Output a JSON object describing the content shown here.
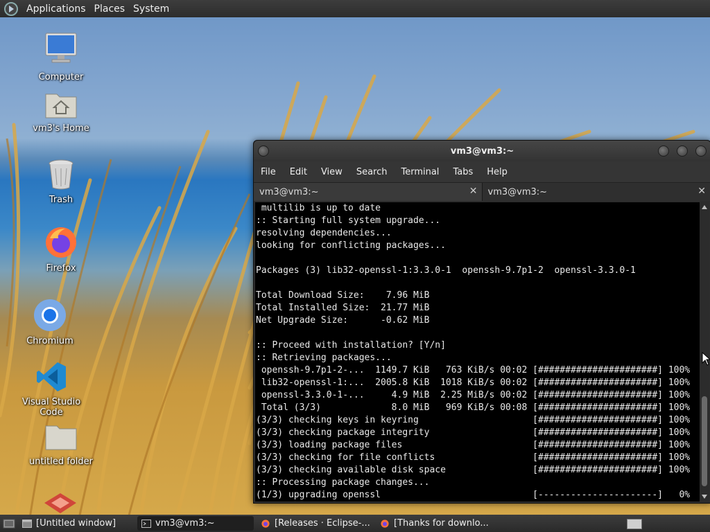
{
  "top_panel": {
    "menus": [
      "Applications",
      "Places",
      "System"
    ]
  },
  "desktop_icons": [
    {
      "label": "Computer",
      "icon": "computer-icon"
    },
    {
      "label": "vm3's Home",
      "icon": "home-folder-icon"
    },
    {
      "label": "Trash",
      "icon": "trash-icon"
    },
    {
      "label": "Firefox",
      "icon": "firefox-icon"
    },
    {
      "label": "Chromium",
      "icon": "chromium-icon"
    },
    {
      "label": "Visual Studio Code",
      "icon": "vscode-icon"
    },
    {
      "label": "untitled folder",
      "icon": "folder-icon"
    }
  ],
  "terminal": {
    "title": "vm3@vm3:~",
    "menu": [
      "File",
      "Edit",
      "View",
      "Search",
      "Terminal",
      "Tabs",
      "Help"
    ],
    "tabs": [
      {
        "label": "vm3@vm3:~",
        "active": false
      },
      {
        "label": "vm3@vm3:~",
        "active": true
      }
    ],
    "lines": [
      " multilib is up to date",
      ":: Starting full system upgrade...",
      "resolving dependencies...",
      "looking for conflicting packages...",
      "",
      "Packages (3) lib32-openssl-1:3.3.0-1  openssh-9.7p1-2  openssl-3.3.0-1",
      "",
      "Total Download Size:    7.96 MiB",
      "Total Installed Size:  21.77 MiB",
      "Net Upgrade Size:      -0.62 MiB",
      "",
      ":: Proceed with installation? [Y/n]",
      ":: Retrieving packages...",
      " openssh-9.7p1-2-...  1149.7 KiB   763 KiB/s 00:02 [######################] 100%",
      " lib32-openssl-1:...  2005.8 KiB  1018 KiB/s 00:02 [######################] 100%",
      " openssl-3.3.0-1-...     4.9 MiB  2.25 MiB/s 00:02 [######################] 100%",
      " Total (3/3)             8.0 MiB   969 KiB/s 00:08 [######################] 100%",
      "(3/3) checking keys in keyring                     [######################] 100%",
      "(3/3) checking package integrity                   [######################] 100%",
      "(3/3) loading package files                        [######################] 100%",
      "(3/3) checking for file conflicts                  [######################] 100%",
      "(3/3) checking available disk space                [######################] 100%",
      ":: Processing package changes...",
      "(1/3) upgrading openssl                            [----------------------]   0%"
    ]
  },
  "taskbar": {
    "tasks": [
      {
        "label": "[Untitled window]",
        "icon": "window-icon",
        "active": false
      },
      {
        "label": "vm3@vm3:~",
        "icon": "terminal-icon",
        "active": true
      },
      {
        "label": "[Releases · Eclipse-...",
        "icon": "firefox-icon",
        "active": false
      },
      {
        "label": "[Thanks for downlo...",
        "icon": "firefox-icon",
        "active": false
      }
    ]
  }
}
